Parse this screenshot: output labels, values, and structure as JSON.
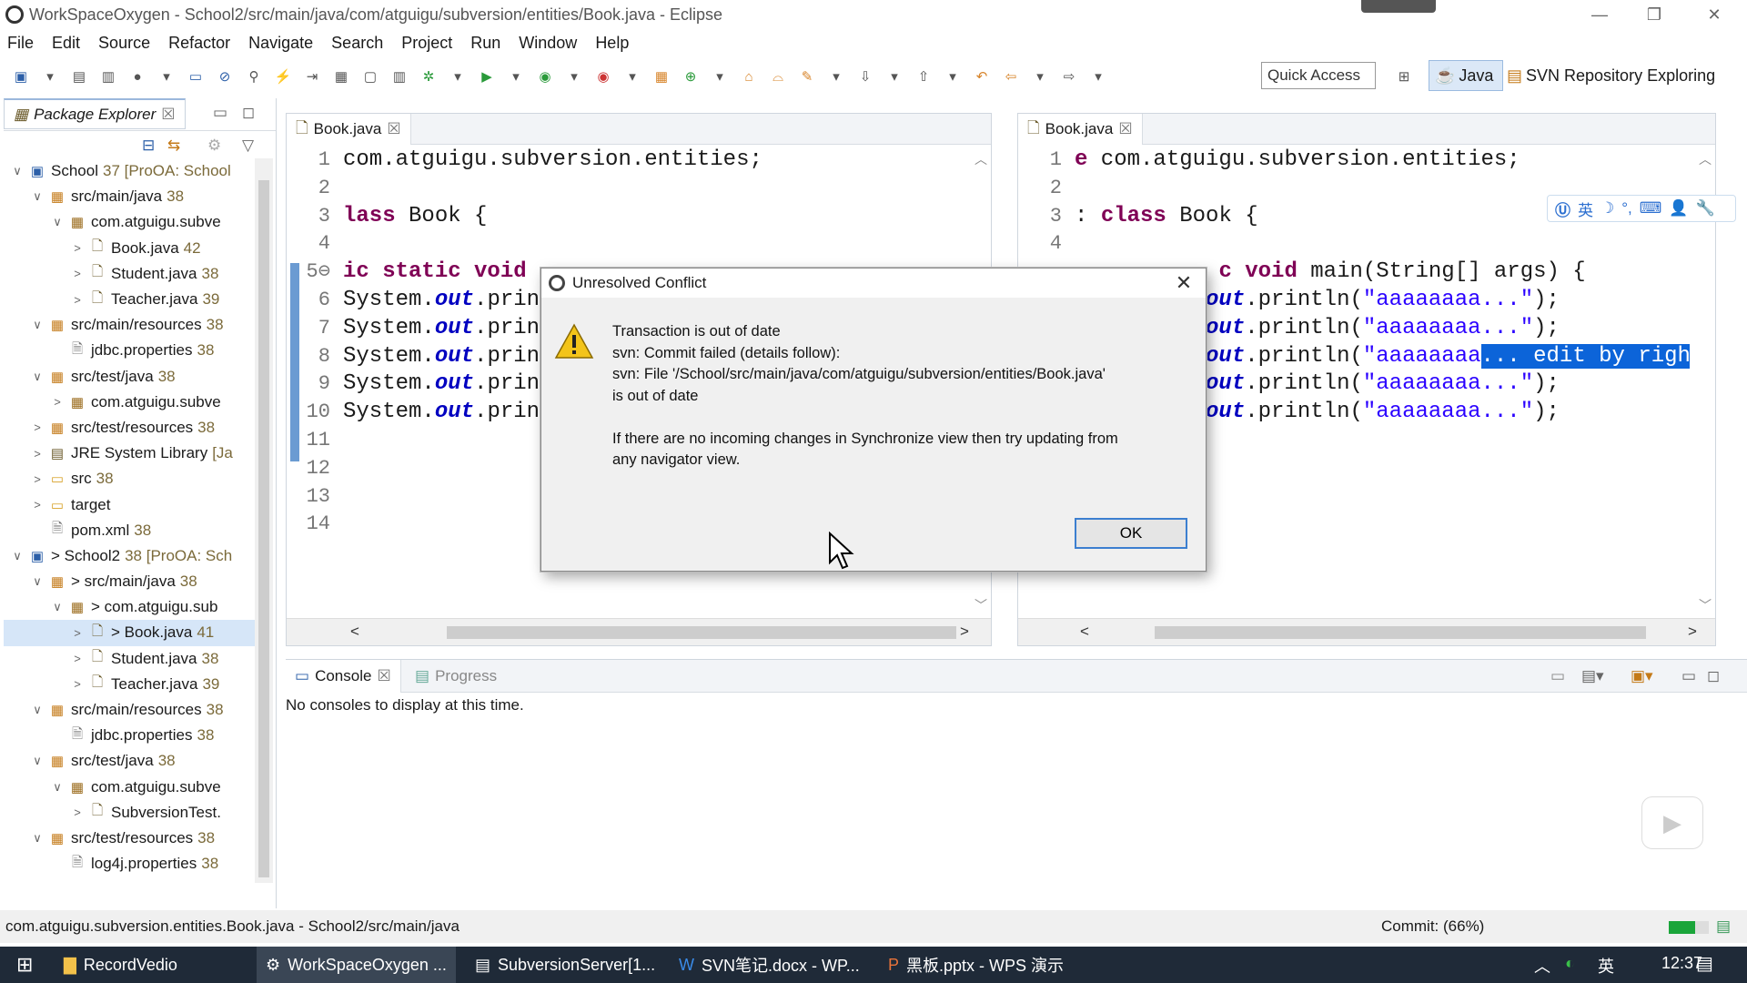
{
  "window": {
    "title": "WorkSpaceOxygen - School2/src/main/java/com/atguigu/subversion/entities/Book.java - Eclipse"
  },
  "menu": [
    "File",
    "Edit",
    "Source",
    "Refactor",
    "Navigate",
    "Search",
    "Project",
    "Run",
    "Window",
    "Help"
  ],
  "toolbar": {
    "quick_access": "Quick Access",
    "perspective_java": "Java",
    "perspective_svn": "SVN Repository Exploring"
  },
  "explorer": {
    "tab_label": "Package Explorer",
    "items": [
      {
        "indent": 0,
        "tw": "∨",
        "icon": "project",
        "text": "School",
        "dec": "37 [ProOA: School"
      },
      {
        "indent": 1,
        "tw": "∨",
        "icon": "src",
        "text": "src/main/java",
        "dec": "38"
      },
      {
        "indent": 2,
        "tw": "∨",
        "icon": "pkg",
        "text": "com.atguigu.subve",
        "dec": ""
      },
      {
        "indent": 3,
        "tw": ">",
        "icon": "java",
        "text": "Book.java",
        "dec": "42"
      },
      {
        "indent": 3,
        "tw": ">",
        "icon": "java",
        "text": "Student.java",
        "dec": "38"
      },
      {
        "indent": 3,
        "tw": ">",
        "icon": "java",
        "text": "Teacher.java",
        "dec": "39"
      },
      {
        "indent": 1,
        "tw": "∨",
        "icon": "src",
        "text": "src/main/resources",
        "dec": "38"
      },
      {
        "indent": 2,
        "tw": "",
        "icon": "file",
        "text": "jdbc.properties",
        "dec": "38"
      },
      {
        "indent": 1,
        "tw": "∨",
        "icon": "src",
        "text": "src/test/java",
        "dec": "38"
      },
      {
        "indent": 2,
        "tw": ">",
        "icon": "pkg",
        "text": "com.atguigu.subve",
        "dec": ""
      },
      {
        "indent": 1,
        "tw": ">",
        "icon": "src",
        "text": "src/test/resources",
        "dec": "38"
      },
      {
        "indent": 1,
        "tw": ">",
        "icon": "lib",
        "text": "JRE System Library",
        "dec": "[Ja"
      },
      {
        "indent": 1,
        "tw": ">",
        "icon": "folder",
        "text": "src",
        "dec": "38"
      },
      {
        "indent": 1,
        "tw": ">",
        "icon": "folder",
        "text": "target",
        "dec": ""
      },
      {
        "indent": 1,
        "tw": "",
        "icon": "file",
        "text": "pom.xml",
        "dec": "38"
      },
      {
        "indent": 0,
        "tw": "∨",
        "icon": "project",
        "text": "> School2",
        "dec": "38 [ProOA: Sch"
      },
      {
        "indent": 1,
        "tw": "∨",
        "icon": "src",
        "text": "> src/main/java",
        "dec": "38"
      },
      {
        "indent": 2,
        "tw": "∨",
        "icon": "pkg",
        "text": "> com.atguigu.sub",
        "dec": ""
      },
      {
        "indent": 3,
        "tw": ">",
        "icon": "java",
        "text": "> Book.java",
        "dec": "41",
        "selected": true
      },
      {
        "indent": 3,
        "tw": ">",
        "icon": "java",
        "text": "Student.java",
        "dec": "38"
      },
      {
        "indent": 3,
        "tw": ">",
        "icon": "java",
        "text": "Teacher.java",
        "dec": "39"
      },
      {
        "indent": 1,
        "tw": "∨",
        "icon": "src",
        "text": "src/main/resources",
        "dec": "38"
      },
      {
        "indent": 2,
        "tw": "",
        "icon": "file",
        "text": "jdbc.properties",
        "dec": "38"
      },
      {
        "indent": 1,
        "tw": "∨",
        "icon": "src",
        "text": "src/test/java",
        "dec": "38"
      },
      {
        "indent": 2,
        "tw": "∨",
        "icon": "pkg",
        "text": "com.atguigu.subve",
        "dec": ""
      },
      {
        "indent": 3,
        "tw": ">",
        "icon": "java",
        "text": "SubversionTest.",
        "dec": ""
      },
      {
        "indent": 1,
        "tw": "∨",
        "icon": "src",
        "text": "src/test/resources",
        "dec": "38"
      },
      {
        "indent": 2,
        "tw": "",
        "icon": "file",
        "text": "log4j.properties",
        "dec": "38"
      }
    ]
  },
  "editor_left": {
    "tab_label": "Book.java",
    "line_numbers": [
      "1",
      "2",
      "3",
      "4",
      "5⊖",
      "6",
      "7",
      "8",
      "9",
      "10",
      "11",
      "12",
      "13",
      "14"
    ],
    "lines": [
      [
        {
          "t": "com.atguigu.subversion.entities;",
          "c": ""
        }
      ],
      [],
      [
        {
          "t": "lass",
          "c": "kw"
        },
        {
          "t": " Book {",
          "c": ""
        }
      ],
      [],
      [
        {
          "t": "ic static void",
          "c": "kw"
        }
      ],
      [
        {
          "t": "System.",
          "c": ""
        },
        {
          "t": "out",
          "c": "fld"
        },
        {
          "t": ".prin",
          "c": ""
        }
      ],
      [
        {
          "t": "System.",
          "c": ""
        },
        {
          "t": "out",
          "c": "fld"
        },
        {
          "t": ".prin",
          "c": ""
        }
      ],
      [
        {
          "t": "System.",
          "c": ""
        },
        {
          "t": "out",
          "c": "fld"
        },
        {
          "t": ".prin",
          "c": ""
        }
      ],
      [
        {
          "t": "System.",
          "c": ""
        },
        {
          "t": "out",
          "c": "fld"
        },
        {
          "t": ".prin",
          "c": ""
        }
      ],
      [
        {
          "t": "System.",
          "c": ""
        },
        {
          "t": "out",
          "c": "fld"
        },
        {
          "t": ".prin",
          "c": ""
        }
      ],
      [],
      [],
      [],
      []
    ]
  },
  "editor_right": {
    "tab_label": "Book.java",
    "line_numbers": [
      "1",
      "2",
      "3",
      "4"
    ],
    "lines": [
      [
        {
          "t": "e",
          "c": "kw"
        },
        {
          "t": " com.atguigu.subversion.entities;",
          "c": ""
        }
      ],
      [],
      [
        {
          "t": ": ",
          "c": ""
        },
        {
          "t": "class",
          "c": "kw"
        },
        {
          "t": " Book {",
          "c": ""
        }
      ],
      [],
      [
        {
          "t": "           ",
          "c": ""
        },
        {
          "t": "c void",
          "c": "kw"
        },
        {
          "t": " main(String[] args) {",
          "c": ""
        }
      ],
      [
        {
          "t": "          ",
          "c": ""
        },
        {
          "t": "out",
          "c": "fld"
        },
        {
          "t": ".println(",
          "c": ""
        },
        {
          "t": "\"aaaaaaaa...\"",
          "c": "str"
        },
        {
          "t": ");",
          "c": ""
        }
      ],
      [
        {
          "t": "          ",
          "c": ""
        },
        {
          "t": "out",
          "c": "fld"
        },
        {
          "t": ".println(",
          "c": ""
        },
        {
          "t": "\"aaaaaaaa...\"",
          "c": "str"
        },
        {
          "t": ");",
          "c": ""
        }
      ],
      [
        {
          "t": "          ",
          "c": ""
        },
        {
          "t": "out",
          "c": "fld"
        },
        {
          "t": ".println(",
          "c": ""
        },
        {
          "t": "\"aaaaaaaa",
          "c": "str"
        },
        {
          "t": "... edit by right",
          "c": "hl"
        }
      ],
      [
        {
          "t": "          ",
          "c": ""
        },
        {
          "t": "out",
          "c": "fld"
        },
        {
          "t": ".println(",
          "c": ""
        },
        {
          "t": "\"aaaaaaaa...\"",
          "c": "str"
        },
        {
          "t": ");",
          "c": ""
        }
      ],
      [
        {
          "t": "          ",
          "c": ""
        },
        {
          "t": "out",
          "c": "fld"
        },
        {
          "t": ".println(",
          "c": ""
        },
        {
          "t": "\"aaaaaaaa...\"",
          "c": "str"
        },
        {
          "t": ");",
          "c": ""
        }
      ]
    ]
  },
  "ime_toolbar": {
    "lang": "英"
  },
  "console": {
    "tab_label": "Console",
    "progress_tab_label": "Progress",
    "empty_message": "No consoles to display at this time."
  },
  "statusbar": {
    "path": "com.atguigu.subversion.entities.Book.java - School2/src/main/java",
    "task": "Commit: (66%)",
    "progress_pct": 66
  },
  "dialog": {
    "title": "Unresolved Conflict",
    "lines": [
      "Transaction is out of date",
      "svn: Commit failed (details follow):",
      "svn: File '/School/src/main/java/com/atguigu/subversion/entities/Book.java'",
      "is out of date",
      "",
      "If there are no incoming changes in Synchronize view then try updating from",
      "any navigator view."
    ],
    "ok_label": "OK"
  },
  "taskbar": {
    "items": [
      "RecordVedio",
      "WorkSpaceOxygen ...",
      "SubversionServer[1...",
      "SVN笔记.docx - WP...",
      "黑板.pptx - WPS 演示"
    ],
    "ime": "英",
    "clock": "12:37"
  },
  "colors": {
    "accent": "#0c64d9",
    "keyword": "#7f0055",
    "string": "#2a00ff",
    "field": "#0000c0",
    "taskbar": "#1f2a38"
  }
}
